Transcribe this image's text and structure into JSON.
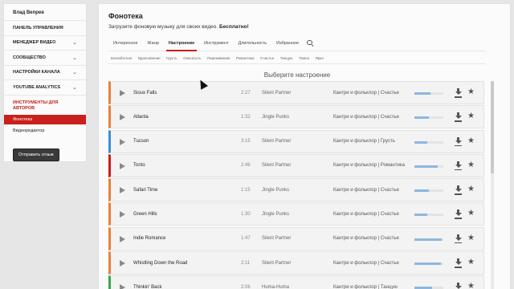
{
  "sidebar": {
    "user_name": "Влад Вепрев",
    "items": [
      {
        "label": "Панель управления",
        "chevron": false
      },
      {
        "label": "Менеджер видео",
        "chevron": true
      },
      {
        "label": "Сообщество",
        "chevron": true
      },
      {
        "label": "Настройки канала",
        "chevron": true
      },
      {
        "label": "YouTube Analytics",
        "chevron": true
      }
    ],
    "section_label": "Инструменты для авторов",
    "active_item": "Фонотека",
    "sub_item": "Видеоредактор",
    "feedback_button": "Отправить отзыв",
    "chevron_glyph": "⌄"
  },
  "main": {
    "title": "Фонотека",
    "subtitle_prefix": "Загрузите фоновую музыку для своих видео.",
    "subtitle_bold": "Бесплатно!",
    "tabs": [
      {
        "label": "Интересное",
        "active": false
      },
      {
        "label": "Жанр",
        "active": false
      },
      {
        "label": "Настроение",
        "active": true
      },
      {
        "label": "Инструмент",
        "active": false
      },
      {
        "label": "Длительность",
        "active": false
      },
      {
        "label": "Избранное",
        "active": false
      }
    ],
    "search_icon": "search-icon",
    "moods": [
      "Беззаботное",
      "Вдохновение",
      "Грусть",
      "Опасность",
      "Переживание",
      "Романтика",
      "Счастье",
      "Танцую",
      "Темно",
      "Ярко"
    ],
    "mood_header": "Выберите настроение"
  },
  "tracks": [
    {
      "title": "Sioux Falls",
      "duration": "2:27",
      "artist": "Silent Partner",
      "genre": "Кантри и фольклор | Счастье",
      "accent": "#e8823a",
      "popularity": 0.55
    },
    {
      "title": "Atlanta",
      "duration": "1:32",
      "artist": "Jingle Punks",
      "genre": "Кантри и фольклор | Счастье",
      "accent": "#e8823a",
      "popularity": 0.5
    },
    {
      "title": "Tucson",
      "duration": "3:15",
      "artist": "Silent Partner",
      "genre": "Кантри и фольклор | Грусть",
      "accent": "#3b8fd6",
      "popularity": 0.45
    },
    {
      "title": "Tonto",
      "duration": "2:46",
      "artist": "Silent Partner",
      "genre": "Кантри и фольклор | Романтика",
      "accent": "#c8201c",
      "popularity": 0.8
    },
    {
      "title": "Safari Time",
      "duration": "1:15",
      "artist": "Jingle Punks",
      "genre": "Кантри и фольклор | Счастье",
      "accent": "#e8823a",
      "popularity": 0.5
    },
    {
      "title": "Green Hills",
      "duration": "1:30",
      "artist": "Jingle Punks",
      "genre": "Кантри и фольклор | Счастье",
      "accent": "#e8823a",
      "popularity": 0.45
    },
    {
      "title": "Indie Romance",
      "duration": "1:47",
      "artist": "Silent Partner",
      "genre": "Кантри и фольклор | Счастье",
      "accent": "#e8823a",
      "popularity": 0.95
    },
    {
      "title": "Whistling Down the Road",
      "duration": "2:11",
      "artist": "Silent Partner",
      "genre": "Кантри и фольклор | Счастье",
      "accent": "#e8823a",
      "popularity": 0.92
    },
    {
      "title": "Thinkin' Back",
      "duration": "2:06",
      "artist": "Huma-Huma",
      "genre": "Кантри и фольклор | Танцую",
      "accent": "#3aa655",
      "popularity": 0.6
    }
  ]
}
